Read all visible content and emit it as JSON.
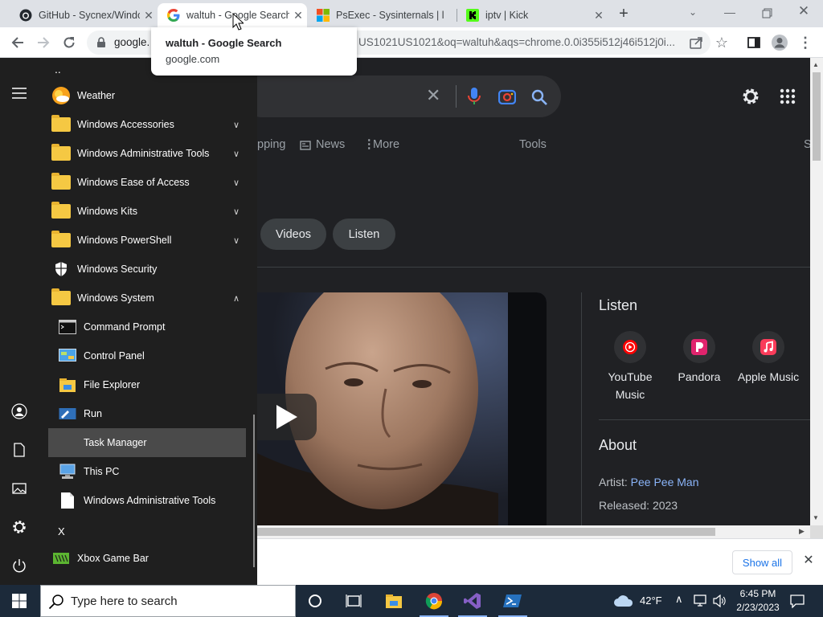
{
  "browser": {
    "tabs": [
      {
        "title": "GitHub - Sycnex/Windo",
        "icon": "github-icon"
      },
      {
        "title": "waltuh - Google Search",
        "icon": "google-icon",
        "active": true
      },
      {
        "title": "PsExec - Sysinternals | l",
        "icon": "microsoft-icon"
      },
      {
        "title": "iptv | Kick",
        "icon": "kick-icon"
      }
    ],
    "new_tab_label": "+",
    "omnibox_host": "google.",
    "omnibox_rest": "US1021US1021&oq=waltuh&aqs=chrome.0.0i355i512j46i512j0i...",
    "tooltip": {
      "title": "waltuh - Google Search",
      "host": "google.com"
    }
  },
  "google": {
    "nav": {
      "partial": "pping",
      "news": "News",
      "more": "More",
      "tools": "Tools",
      "edge": "S"
    },
    "chips": [
      "Videos",
      "Listen"
    ],
    "listen": {
      "heading": "Listen",
      "services": [
        {
          "name": "YouTube Music",
          "icon": "youtube-music-icon"
        },
        {
          "name": "Pandora",
          "icon": "pandora-icon"
        },
        {
          "name": "Apple Music",
          "icon": "apple-music-icon"
        }
      ]
    },
    "about": {
      "heading": "About",
      "artist_label": "Artist:",
      "artist_value": "Pee Pee Man",
      "released_label": "Released:",
      "released_value": "2023"
    }
  },
  "download_bar": {
    "show_all": "Show all"
  },
  "start_menu": {
    "top_letter": "..",
    "items": [
      {
        "label": "Weather",
        "icon": "weather-icon",
        "type": "app"
      },
      {
        "label": "Windows Accessories",
        "icon": "folder-icon",
        "type": "folder",
        "expanded": false
      },
      {
        "label": "Windows Administrative Tools",
        "icon": "folder-icon",
        "type": "folder",
        "expanded": false
      },
      {
        "label": "Windows Ease of Access",
        "icon": "folder-icon",
        "type": "folder",
        "expanded": false
      },
      {
        "label": "Windows Kits",
        "icon": "folder-icon",
        "type": "folder",
        "expanded": false
      },
      {
        "label": "Windows PowerShell",
        "icon": "folder-icon",
        "type": "folder",
        "expanded": false
      },
      {
        "label": "Windows Security",
        "icon": "shield-icon",
        "type": "app"
      },
      {
        "label": "Windows System",
        "icon": "folder-icon",
        "type": "folder",
        "expanded": true
      },
      {
        "label": "Command Prompt",
        "icon": "cmd-icon",
        "type": "sub"
      },
      {
        "label": "Control Panel",
        "icon": "control-panel-icon",
        "type": "sub"
      },
      {
        "label": "File Explorer",
        "icon": "file-explorer-icon",
        "type": "sub"
      },
      {
        "label": "Run",
        "icon": "run-icon",
        "type": "sub"
      },
      {
        "label": "Task Manager",
        "icon": "task-manager-icon",
        "type": "sub",
        "highlighted": true
      },
      {
        "label": "This PC",
        "icon": "this-pc-icon",
        "type": "sub"
      },
      {
        "label": "Windows Administrative Tools",
        "icon": "document-icon",
        "type": "sub"
      }
    ],
    "letter_x": "X",
    "xbox": {
      "label": "Xbox Game Bar",
      "icon": "xbox-icon"
    }
  },
  "taskbar": {
    "search_placeholder": "Type here to search",
    "weather": "42°F",
    "time": "6:45 PM",
    "date": "2/23/2023"
  },
  "colors": {
    "accent_link": "#8ab4f8",
    "taskbar": "#1c2a3a",
    "start_bg": "#1f1f1f"
  }
}
